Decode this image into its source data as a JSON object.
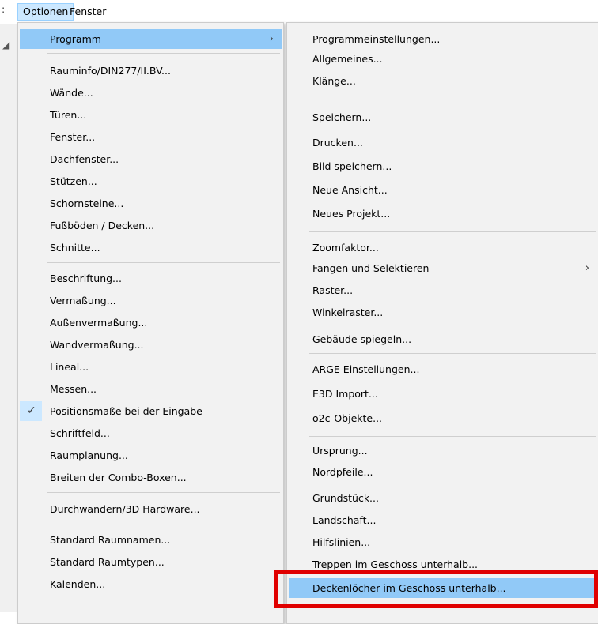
{
  "menubar": {
    "cut_left": ":",
    "items": [
      {
        "label": "Optionen"
      },
      {
        "label": "Fenster"
      }
    ]
  },
  "menu_main": {
    "items": [
      {
        "label": "Programm",
        "arrow": "›"
      },
      {
        "label": "Rauminfo/DIN277/II.BV..."
      },
      {
        "label": "Wände..."
      },
      {
        "label": "Türen..."
      },
      {
        "label": "Fenster..."
      },
      {
        "label": "Dachfenster..."
      },
      {
        "label": "Stützen..."
      },
      {
        "label": "Schornsteine..."
      },
      {
        "label": "Fußböden / Decken..."
      },
      {
        "label": "Schnitte..."
      },
      {
        "label": "Beschriftung..."
      },
      {
        "label": "Vermaßung..."
      },
      {
        "label": "Außenvermaßung..."
      },
      {
        "label": "Wandvermaßung..."
      },
      {
        "label": "Lineal..."
      },
      {
        "label": "Messen..."
      },
      {
        "label": "Positionsmaße bei der Eingabe",
        "check": "✓"
      },
      {
        "label": "Schriftfeld..."
      },
      {
        "label": "Raumplanung..."
      },
      {
        "label": "Breiten der Combo-Boxen..."
      },
      {
        "label": "Durchwandern/3D Hardware..."
      },
      {
        "label": "Standard Raumnamen..."
      },
      {
        "label": "Standard Raumtypen..."
      },
      {
        "label": "Kalenden..."
      }
    ]
  },
  "menu_sub": {
    "items": [
      {
        "label": "Programmeinstellungen..."
      },
      {
        "label": "Allgemeines..."
      },
      {
        "label": "Klänge..."
      },
      {
        "label": "Speichern..."
      },
      {
        "label": "Drucken..."
      },
      {
        "label": "Bild speichern..."
      },
      {
        "label": "Neue Ansicht..."
      },
      {
        "label": "Neues Projekt..."
      },
      {
        "label": "Zoomfaktor..."
      },
      {
        "label": "Fangen und Selektieren",
        "arrow": "›"
      },
      {
        "label": "Raster..."
      },
      {
        "label": "Winkelraster..."
      },
      {
        "label": "Gebäude spiegeln..."
      },
      {
        "label": "ARGE Einstellungen..."
      },
      {
        "label": "E3D Import..."
      },
      {
        "label": "o2c-Objekte..."
      },
      {
        "label": "Ursprung..."
      },
      {
        "label": "Nordpfeile..."
      },
      {
        "label": "Grundstück..."
      },
      {
        "label": "Landschaft..."
      },
      {
        "label": "Hilfslinien..."
      },
      {
        "label": "Treppen im Geschoss unterhalb..."
      },
      {
        "label": "Deckenlöcher im Geschoss unterhalb..."
      }
    ]
  },
  "colors": {
    "highlight": "#91c9f7",
    "menu_bg": "#f2f2f2",
    "annotation": "#e00000"
  },
  "icons": {
    "submenu_arrow": "chevron-right-icon",
    "checkmark": "check-icon"
  }
}
